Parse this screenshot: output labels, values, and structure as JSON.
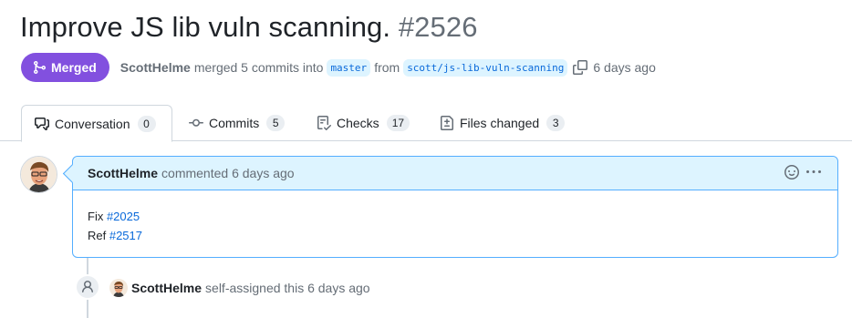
{
  "pr": {
    "title": "Improve JS lib vuln scanning.",
    "number": "#2526",
    "status": "Merged",
    "author": "ScottHelme",
    "merge_text": "merged 5 commits into",
    "base_branch": "master",
    "from_text": "from",
    "head_branch": "scott/js-lib-vuln-scanning",
    "time": "6 days ago"
  },
  "tabs": [
    {
      "label": "Conversation",
      "count": "0",
      "icon": "comment-discussion-icon"
    },
    {
      "label": "Commits",
      "count": "5",
      "icon": "commit-icon"
    },
    {
      "label": "Checks",
      "count": "17",
      "icon": "checklist-icon"
    },
    {
      "label": "Files changed",
      "count": "3",
      "icon": "file-diff-icon"
    }
  ],
  "comment": {
    "author": "ScottHelme",
    "meta": "commented 6 days ago",
    "lines": [
      {
        "prefix": "Fix ",
        "link": "#2025"
      },
      {
        "prefix": "Ref ",
        "link": "#2517"
      }
    ]
  },
  "event": {
    "author": "ScottHelme",
    "text": "self-assigned this 6 days ago",
    "icon": "person-icon"
  },
  "colors": {
    "merged": "#8250df",
    "link": "#0969da",
    "comment_header_bg": "#ddf4ff",
    "comment_border": "#54aeff"
  }
}
